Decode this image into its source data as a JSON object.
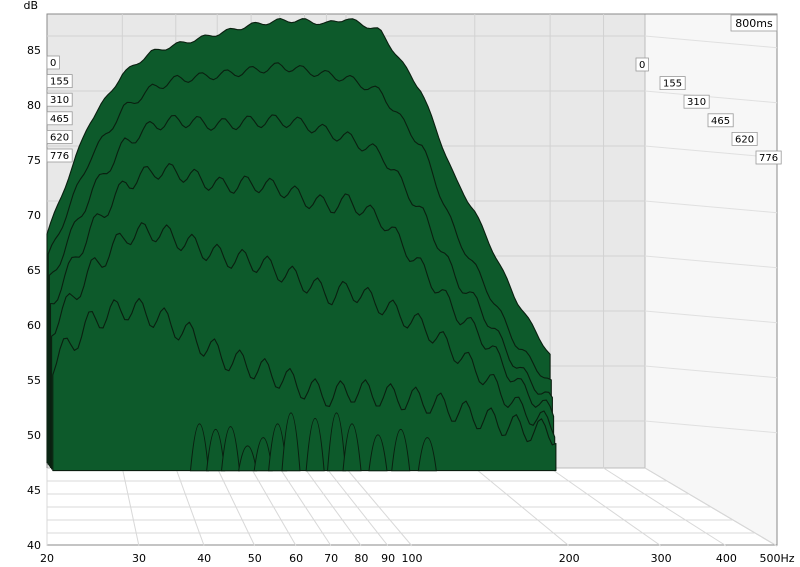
{
  "chart_data": {
    "type": "area",
    "y_unit": "dB",
    "x_unit": "Hz",
    "time_window_label": "800ms",
    "ylim": [
      40,
      87
    ],
    "xlim": [
      20,
      500
    ],
    "x_scale": "log",
    "y_ticks": [
      85,
      80,
      75,
      70,
      65,
      60,
      55,
      50,
      45,
      40
    ],
    "x_ticks": [
      {
        "v": 20,
        "label": "20"
      },
      {
        "v": 30,
        "label": "30"
      },
      {
        "v": 40,
        "label": "40"
      },
      {
        "v": 50,
        "label": "50"
      },
      {
        "v": 60,
        "label": "60"
      },
      {
        "v": 70,
        "label": "70"
      },
      {
        "v": 80,
        "label": "80"
      },
      {
        "v": 90,
        "label": "90"
      },
      {
        "v": 100,
        "label": "100"
      },
      {
        "v": 200,
        "label": "200"
      },
      {
        "v": 300,
        "label": "300"
      },
      {
        "v": 400,
        "label": "400"
      },
      {
        "v": 500,
        "label": "500Hz"
      }
    ],
    "time_labels": [
      "0",
      "155",
      "310",
      "465",
      "620",
      "776"
    ],
    "fill_color": "#0d5a2b",
    "line_color": "#0a1f10",
    "grid": true,
    "series": [
      {
        "t": 0,
        "x": [
          20,
          25,
          30,
          35,
          40,
          50,
          60,
          70,
          80,
          90,
          100,
          120,
          150,
          180,
          200,
          250,
          300
        ],
        "y": [
          67,
          77,
          81.5,
          83.5,
          84.2,
          85.2,
          86,
          86.4,
          86.4,
          86.1,
          86.6,
          85.5,
          80,
          72,
          69,
          61,
          56
        ]
      },
      {
        "t": 155,
        "x": [
          20,
          25,
          30,
          35,
          40,
          50,
          60,
          70,
          80,
          90,
          100,
          120,
          150,
          180,
          200,
          250,
          300
        ],
        "y": [
          65,
          74,
          78.5,
          80.4,
          81.2,
          81.6,
          82,
          82.4,
          82,
          81.6,
          81.3,
          80,
          75,
          67,
          64,
          57,
          53.5
        ]
      },
      {
        "t": 310,
        "x": [
          20,
          25,
          30,
          35,
          40,
          50,
          60,
          70,
          80,
          90,
          100,
          120,
          150,
          180,
          200,
          250,
          300
        ],
        "y": [
          63,
          71,
          75.5,
          77.2,
          77.6,
          77.2,
          77.5,
          77.6,
          77.2,
          76.5,
          76,
          74.5,
          69,
          63,
          61,
          55,
          52
        ]
      },
      {
        "t": 465,
        "x": [
          20,
          25,
          30,
          35,
          40,
          50,
          60,
          70,
          80,
          90,
          100,
          120,
          150,
          180,
          200,
          250,
          300
        ],
        "y": [
          61,
          68,
          72,
          73.2,
          73,
          71.8,
          72,
          71.5,
          70.5,
          70,
          70.4,
          68.6,
          64,
          60,
          58.5,
          53.6,
          51
        ]
      },
      {
        "t": 620,
        "x": [
          20,
          25,
          30,
          35,
          40,
          50,
          60,
          70,
          80,
          90,
          100,
          120,
          150,
          180,
          200,
          250,
          300
        ],
        "y": [
          59,
          64.5,
          67.5,
          67.8,
          67,
          65.5,
          65,
          64,
          63,
          62,
          62.5,
          61,
          59,
          56.5,
          55,
          51.6,
          50
        ]
      },
      {
        "t": 776,
        "x": [
          20,
          25,
          30,
          35,
          40,
          50,
          60,
          70,
          80,
          90,
          100,
          120,
          150,
          180,
          200,
          250,
          300
        ],
        "y": [
          56,
          60,
          61,
          60.2,
          59,
          56.5,
          55.5,
          54.5,
          53.5,
          53,
          53.5,
          53,
          52.5,
          51.5,
          51,
          50,
          49.6
        ]
      }
    ]
  }
}
